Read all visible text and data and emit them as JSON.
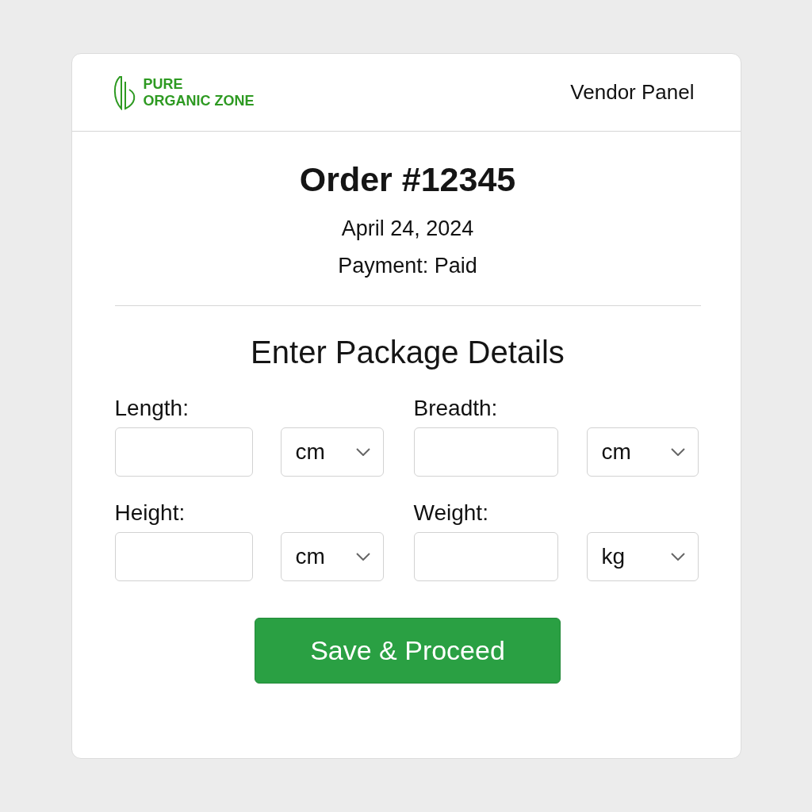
{
  "header": {
    "logo_line_1": "PURE",
    "logo_line_2": "ORGANIC ZONE",
    "panel_label": "Vendor Panel"
  },
  "order": {
    "title": "Order #12345",
    "date": "April 24, 2024",
    "payment": "Payment: Paid"
  },
  "section_title": "Enter Package Details",
  "fields": [
    {
      "label": "Length:",
      "unit": "cm"
    },
    {
      "label": "Breadth:",
      "unit": "cm"
    },
    {
      "label": "Height:",
      "unit": "cm"
    },
    {
      "label": "Weight:",
      "unit": "kg"
    }
  ],
  "button": "Save & Proceed"
}
